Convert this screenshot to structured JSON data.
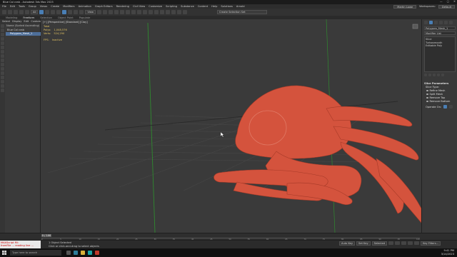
{
  "window": {
    "title": "Blue Cal crab - Autodesk 3ds Max 2023",
    "controls": [
      "—",
      "▢",
      "✕"
    ]
  },
  "menubar": {
    "items": [
      "File",
      "Edit",
      "Tools",
      "Group",
      "Views",
      "Create",
      "Modifiers",
      "Animation",
      "Graph Editors",
      "Rendering",
      "Civil View",
      "Customize",
      "Scripting",
      "Substance",
      "Content",
      "Help",
      "Solutions",
      "Arnold"
    ],
    "sign_in": "Martin Lowe",
    "workspaces": "Workspaces:",
    "workspace_value": "Default"
  },
  "toolbar": {
    "selection_filter": "All",
    "view_dropdown": "View",
    "named_selection": "Create Selection Set"
  },
  "ribbon": {
    "tabs": [
      "Modeling",
      "Freeform",
      "Selection",
      "Object Paint",
      "Populate"
    ]
  },
  "scene_explorer": {
    "tabs": [
      "Select",
      "Display",
      "Edit",
      "Customize"
    ],
    "header": "Name (Sorted Ascending)",
    "rows": [
      "Blue Cal crab",
      "Polygons_Mesh_1"
    ],
    "footer": "Layer Explorer"
  },
  "viewport": {
    "label": "[+] [Perspective] [Standard] [Clay]",
    "stats": [
      {
        "label": "Total",
        "value": ""
      },
      {
        "label": "Polys:",
        "value": "1,048,576"
      },
      {
        "label": "Verts:",
        "value": "524,290"
      },
      {
        "label": "",
        "value": ""
      },
      {
        "label": "FPS:",
        "value": "Inactive"
      }
    ],
    "model_color": "#d4533d",
    "grid_green": "#2f8a2f"
  },
  "command_panel": {
    "object_name": "Polygons_Mesh_1",
    "modifier_list": "Modifier List",
    "stack": [
      "Slice",
      "Turbosmooth",
      "Editable Poly"
    ],
    "rollout_title": "Slice Parameters",
    "slice_type_label": "Slice Type:",
    "options": [
      {
        "label": "Refine Mesh",
        "on": false
      },
      {
        "label": "Split Mesh",
        "on": false
      },
      {
        "label": "Remove Top",
        "on": false
      },
      {
        "label": "Remove Bottom",
        "on": true
      }
    ],
    "operate_on": "Operate On:"
  },
  "timeline": {
    "frame": "0 / 100",
    "ticks": [
      "0",
      "5",
      "10",
      "15",
      "20",
      "25",
      "30",
      "35",
      "40",
      "45",
      "50",
      "55",
      "60",
      "65",
      "70",
      "75",
      "80",
      "85",
      "90",
      "95",
      "100"
    ]
  },
  "statusbar": {
    "maxscript": "MAXScript Mi:",
    "maxscript_line": "fromFile ... reading line ...",
    "selected": "1 Object Selected",
    "prompt": "Click or click-and-drag to select objects",
    "autokey": "Auto Key",
    "setkey": "Set Key",
    "selected_dropdown": "Selected",
    "key_filters": "Key Filters..."
  },
  "taskbar": {
    "search_placeholder": "Type here to search",
    "time": "9:41 PM",
    "date": "3/14/2023"
  }
}
